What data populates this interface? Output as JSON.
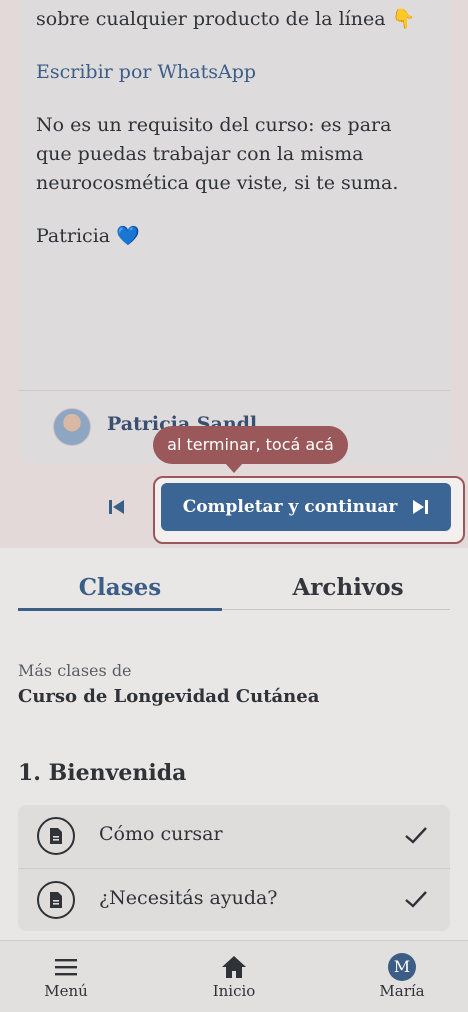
{
  "message": {
    "line_partial": "sobre cualquier producto de la línea 👇",
    "whatsapp_link": "Escribir por WhatsApp",
    "paragraph_1": "No es un requisito del curso: es para",
    "paragraph_2": "que puedas trabajar con la misma",
    "paragraph_3": "neurocosmética que viste, si te suma.",
    "signature": "Patricia",
    "signature_emoji": "💙",
    "author_name": "Patricia Sandl"
  },
  "tooltip": "al terminar, tocá acá",
  "actions": {
    "complete_label": "Completar y continuar"
  },
  "tabs": [
    {
      "label": "Clases",
      "active": true
    },
    {
      "label": "Archivos",
      "active": false
    }
  ],
  "course": {
    "more_label": "Más clases de",
    "title": "Curso de Longevidad Cutánea"
  },
  "section": {
    "title": "1. Bienvenida",
    "lessons": [
      {
        "label": "Cómo cursar",
        "completed": true
      },
      {
        "label": "¿Necesitás ayuda?",
        "completed": true
      }
    ]
  },
  "bottom_nav": [
    {
      "label": "Menú",
      "icon": "menu-icon"
    },
    {
      "label": "Inicio",
      "icon": "home-icon"
    },
    {
      "label": "María",
      "icon": "avatar",
      "initial": "M"
    }
  ],
  "colors": {
    "accent": "#3b5d86",
    "tooltip": "#9a585a"
  }
}
